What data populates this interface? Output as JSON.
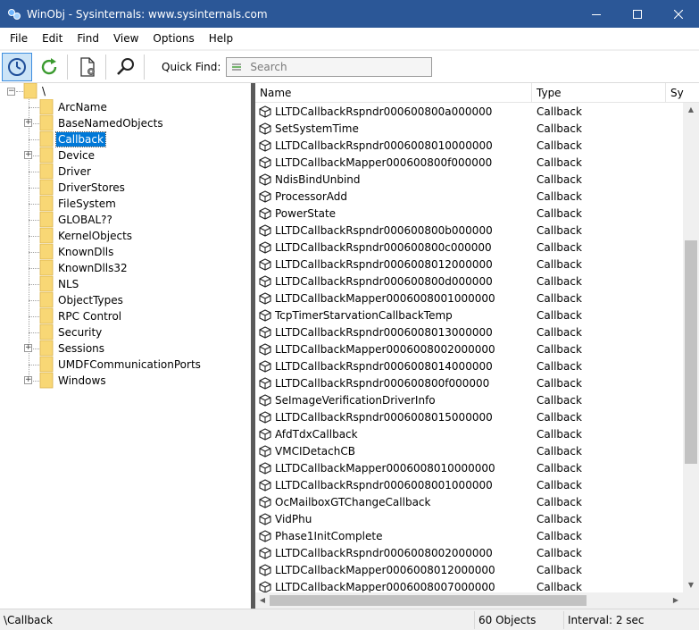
{
  "window": {
    "title": "WinObj - Sysinternals: www.sysinternals.com"
  },
  "menu": [
    "File",
    "Edit",
    "Find",
    "View",
    "Options",
    "Help"
  ],
  "toolbar": {
    "buttons": [
      "refresh-auto-icon",
      "refresh-icon",
      "properties-icon",
      "find-icon"
    ],
    "quick_find_label": "Quick Find:",
    "search_placeholder": "Search"
  },
  "tree": {
    "root": "\\",
    "items": [
      {
        "label": "ArcName",
        "expandable": false
      },
      {
        "label": "BaseNamedObjects",
        "expandable": true
      },
      {
        "label": "Callback",
        "expandable": false,
        "selected": true
      },
      {
        "label": "Device",
        "expandable": true
      },
      {
        "label": "Driver",
        "expandable": false
      },
      {
        "label": "DriverStores",
        "expandable": false
      },
      {
        "label": "FileSystem",
        "expandable": false
      },
      {
        "label": "GLOBAL??",
        "expandable": false
      },
      {
        "label": "KernelObjects",
        "expandable": false
      },
      {
        "label": "KnownDlls",
        "expandable": false
      },
      {
        "label": "KnownDlls32",
        "expandable": false
      },
      {
        "label": "NLS",
        "expandable": false
      },
      {
        "label": "ObjectTypes",
        "expandable": false
      },
      {
        "label": "RPC Control",
        "expandable": false
      },
      {
        "label": "Security",
        "expandable": false
      },
      {
        "label": "Sessions",
        "expandable": true
      },
      {
        "label": "UMDFCommunicationPorts",
        "expandable": false
      },
      {
        "label": "Windows",
        "expandable": true
      }
    ]
  },
  "list": {
    "columns": [
      "Name",
      "Type",
      "Sy"
    ],
    "rows": [
      {
        "name": "LLTDCallbackRspndr000600800a000000",
        "type": "Callback"
      },
      {
        "name": "SetSystemTime",
        "type": "Callback"
      },
      {
        "name": "LLTDCallbackRspndr0006008010000000",
        "type": "Callback"
      },
      {
        "name": "LLTDCallbackMapper000600800f000000",
        "type": "Callback"
      },
      {
        "name": "NdisBindUnbind",
        "type": "Callback"
      },
      {
        "name": "ProcessorAdd",
        "type": "Callback"
      },
      {
        "name": "PowerState",
        "type": "Callback"
      },
      {
        "name": "LLTDCallbackRspndr000600800b000000",
        "type": "Callback"
      },
      {
        "name": "LLTDCallbackRspndr000600800c000000",
        "type": "Callback"
      },
      {
        "name": "LLTDCallbackRspndr0006008012000000",
        "type": "Callback"
      },
      {
        "name": "LLTDCallbackRspndr000600800d000000",
        "type": "Callback"
      },
      {
        "name": "LLTDCallbackMapper0006008001000000",
        "type": "Callback"
      },
      {
        "name": "TcpTimerStarvationCallbackTemp",
        "type": "Callback"
      },
      {
        "name": "LLTDCallbackRspndr0006008013000000",
        "type": "Callback"
      },
      {
        "name": "LLTDCallbackMapper0006008002000000",
        "type": "Callback"
      },
      {
        "name": "LLTDCallbackRspndr0006008014000000",
        "type": "Callback"
      },
      {
        "name": "LLTDCallbackRspndr000600800f000000",
        "type": "Callback"
      },
      {
        "name": "SeImageVerificationDriverInfo",
        "type": "Callback"
      },
      {
        "name": "LLTDCallbackRspndr0006008015000000",
        "type": "Callback"
      },
      {
        "name": "AfdTdxCallback",
        "type": "Callback"
      },
      {
        "name": "VMCIDetachCB",
        "type": "Callback"
      },
      {
        "name": "LLTDCallbackMapper0006008010000000",
        "type": "Callback"
      },
      {
        "name": "LLTDCallbackRspndr0006008001000000",
        "type": "Callback"
      },
      {
        "name": "OcMailboxGTChangeCallback",
        "type": "Callback"
      },
      {
        "name": "VidPhu",
        "type": "Callback"
      },
      {
        "name": "Phase1InitComplete",
        "type": "Callback"
      },
      {
        "name": "LLTDCallbackRspndr0006008002000000",
        "type": "Callback"
      },
      {
        "name": "LLTDCallbackMapper0006008012000000",
        "type": "Callback"
      },
      {
        "name": "LLTDCallbackMapper0006008007000000",
        "type": "Callback"
      }
    ]
  },
  "status": {
    "path": "\\Callback",
    "count": "60 Objects",
    "interval": "Interval: 2 sec"
  },
  "colors": {
    "titlebar": "#2b5797",
    "selection": "#0078d7",
    "folder": "#f8d775"
  }
}
